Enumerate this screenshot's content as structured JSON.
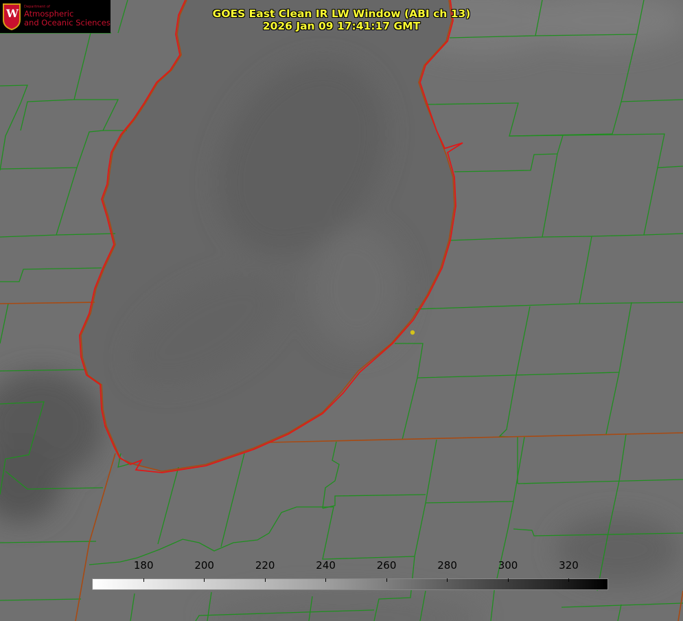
{
  "title": {
    "line1": "GOES East Clean IR LW Window (ABI ch 13)",
    "line2": "2026 Jan 09 17:41:17 GMT"
  },
  "logo": {
    "crest_letter": "W",
    "dept": "Department of",
    "line1": "Atmospheric",
    "line2": "and Oceanic Sciences"
  },
  "colorbar": {
    "ticks": [
      "180",
      "200",
      "220",
      "240",
      "260",
      "280",
      "300",
      "320"
    ],
    "tick_values": [
      180,
      200,
      220,
      240,
      260,
      280,
      300,
      320
    ],
    "range": [
      163,
      333
    ],
    "colormap": "white-to-black"
  },
  "colors": {
    "county_lines": "#1f8f1f",
    "state_lines": "#b04a10",
    "lake_outline": "#e01818",
    "marker": "#d4c21a",
    "title_text": "#ffff33",
    "brand": "#c8102e"
  }
}
